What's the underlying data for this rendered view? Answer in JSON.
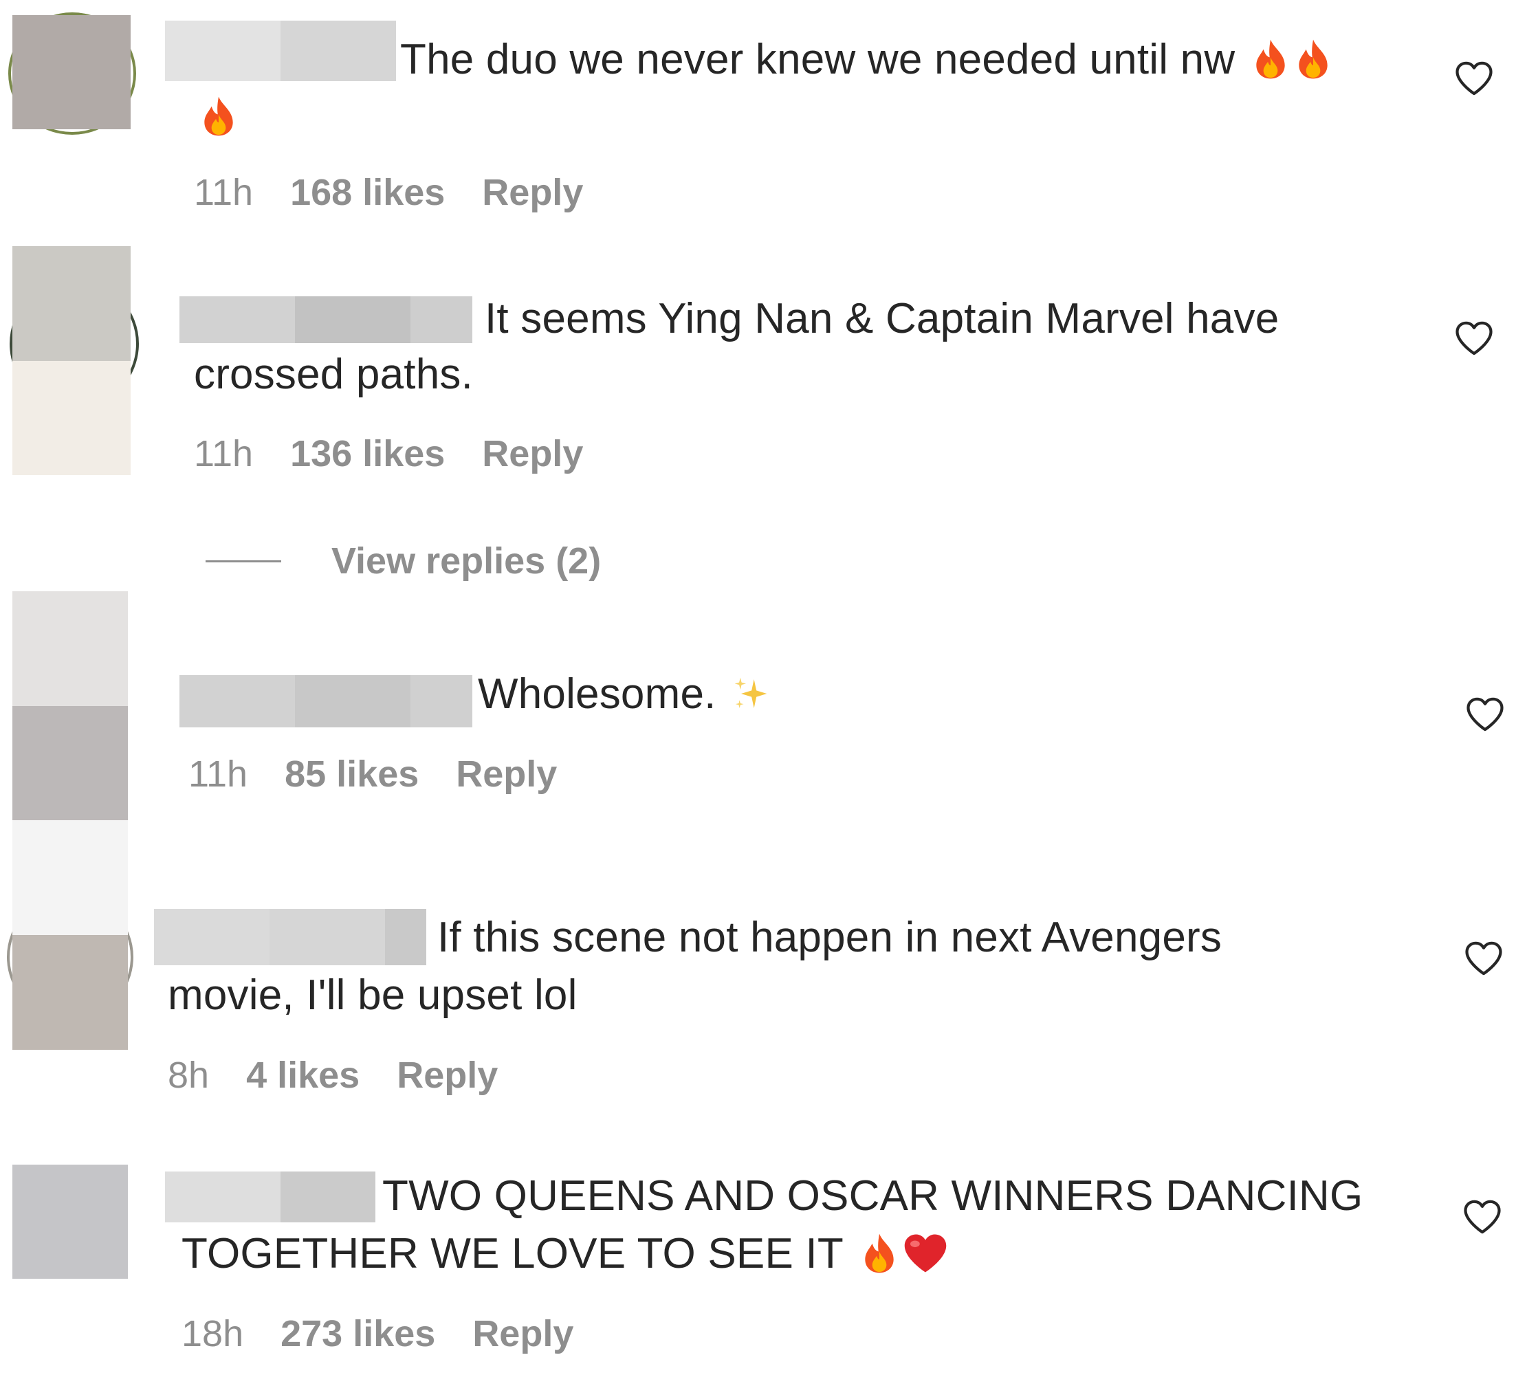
{
  "icons": {
    "like": "heart-outline-icon",
    "fire": "fire-emoji",
    "sparkles": "sparkles-emoji",
    "red_heart": "red-heart-emoji"
  },
  "colors": {
    "text": "#262626",
    "meta": "#8e8e8e",
    "fire_outer": "#f4511e",
    "fire_inner": "#ffb300",
    "red_heart": "#e0242b",
    "sparkle": "#f5c542"
  },
  "comments": [
    {
      "text_line1": "The duo we never knew we needed until nw",
      "time": "11h",
      "likes": "168 likes",
      "reply": "Reply"
    },
    {
      "text_line1": "It seems Ying Nan & Captain Marvel have",
      "text_line2": "crossed paths.",
      "time": "11h",
      "likes": "136 likes",
      "reply": "Reply",
      "view_replies": "View replies (2)"
    },
    {
      "text_line1": "Wholesome.",
      "time": "11h",
      "likes": "85 likes",
      "reply": "Reply"
    },
    {
      "text_line1": "If this scene not happen in next Avengers",
      "text_line2": "movie, I'll be upset lol",
      "time": "8h",
      "likes": "4 likes",
      "reply": "Reply"
    },
    {
      "text_line1": "TWO QUEENS AND OSCAR WINNERS DANCING",
      "text_line2": "TOGETHER WE LOVE TO SEE IT",
      "time": "18h",
      "likes": "273 likes",
      "reply": "Reply"
    }
  ]
}
